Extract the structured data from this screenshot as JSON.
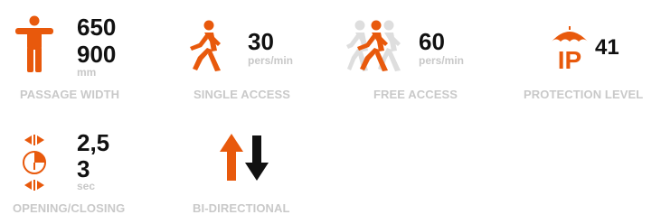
{
  "colors": {
    "accent": "#e8590c",
    "value_text": "#111111",
    "muted": "#c8c8c8",
    "ghost": "#dedede"
  },
  "specs": [
    {
      "id": "passage-width",
      "icon": "standing-person-arms-out-icon",
      "values": [
        "650",
        "900"
      ],
      "unit": "mm",
      "label": "PASSAGE WIDTH"
    },
    {
      "id": "single-access",
      "icon": "walking-person-icon",
      "values": [
        "30"
      ],
      "unit": "pers/min",
      "label": "SINGLE ACCESS"
    },
    {
      "id": "free-access",
      "icon": "walking-group-icon",
      "values": [
        "60"
      ],
      "unit": "pers/min",
      "label": "FREE ACCESS"
    },
    {
      "id": "protection-level",
      "icon": "umbrella-ip-icon",
      "values": [
        "41"
      ],
      "label": "PROTECTION LEVEL"
    },
    {
      "id": "opening-closing",
      "icon": "timer-arrows-icon",
      "values": [
        "2,5",
        "3"
      ],
      "unit": "sec",
      "label": "OPENING/CLOSING"
    },
    {
      "id": "bi-directional",
      "icon": "up-down-arrows-icon",
      "label": "BI-DIRECTIONAL"
    }
  ],
  "protection": {
    "ip_letters": "IP"
  }
}
